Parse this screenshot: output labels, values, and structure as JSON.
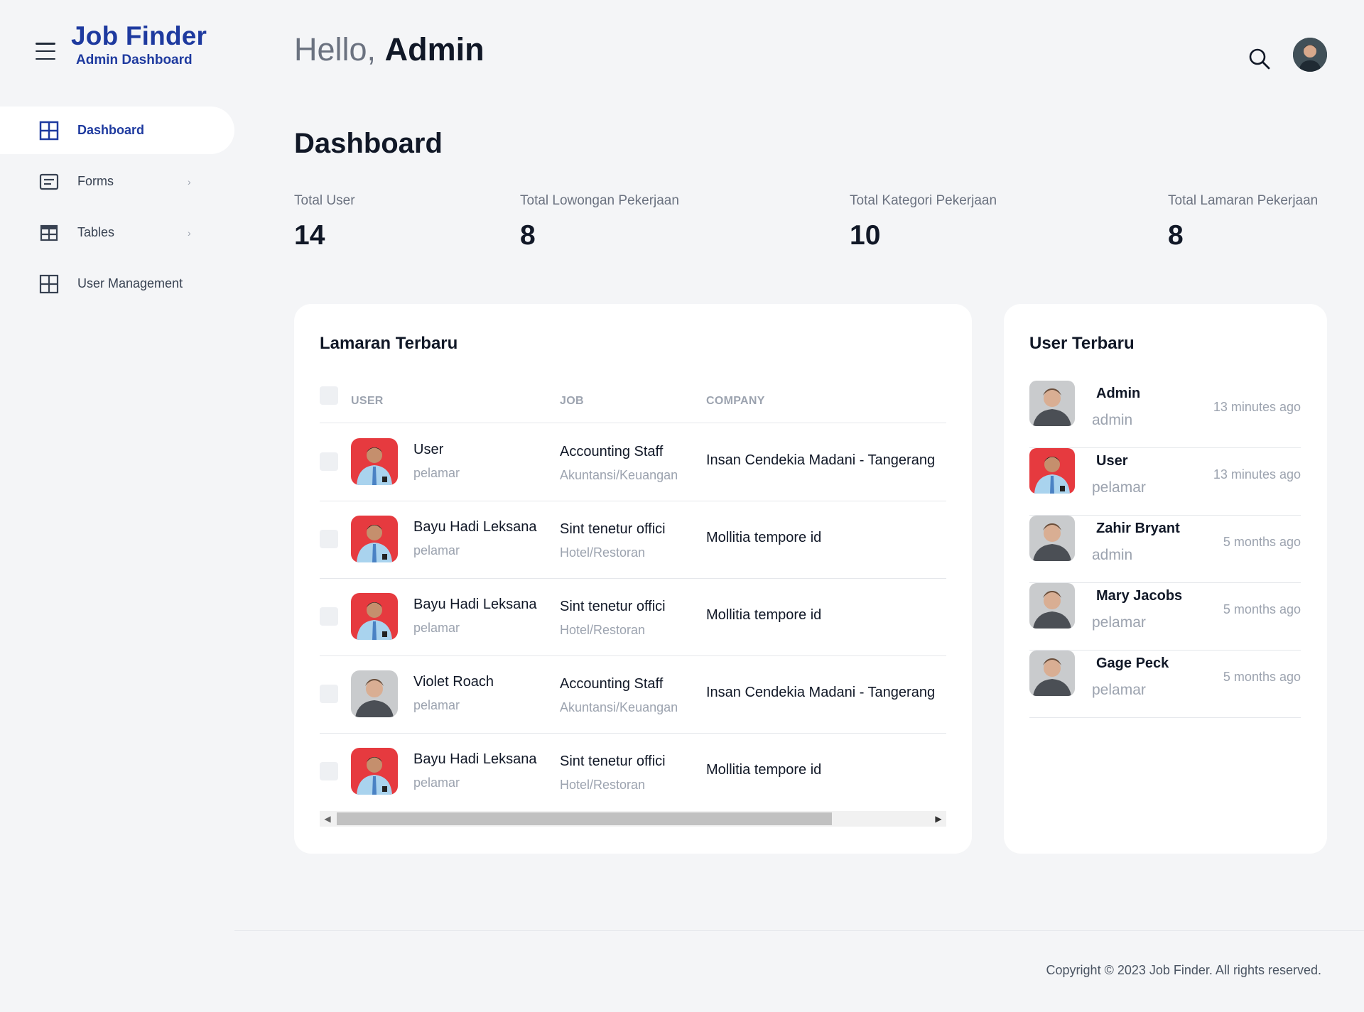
{
  "brand": {
    "title": "Job Finder",
    "subtitle": "Admin Dashboard"
  },
  "sidebar": {
    "items": [
      {
        "label": "Dashboard",
        "icon": "grid-icon",
        "active": true
      },
      {
        "label": "Forms",
        "icon": "form-icon",
        "has_submenu": true
      },
      {
        "label": "Tables",
        "icon": "table-icon",
        "has_submenu": true
      },
      {
        "label": "User Management",
        "icon": "grid-icon"
      }
    ],
    "chevron": "›"
  },
  "header": {
    "hello": "Hello,",
    "name": "Admin"
  },
  "page": {
    "title": "Dashboard"
  },
  "stats": [
    {
      "label": "Total User",
      "value": "14"
    },
    {
      "label": "Total Lowongan Pekerjaan",
      "value": "8"
    },
    {
      "label": "Total Kategori Pekerjaan",
      "value": "10"
    },
    {
      "label": "Total Lamaran Pekerjaan",
      "value": "8"
    }
  ],
  "applications": {
    "title": "Lamaran Terbaru",
    "columns": {
      "user": "USER",
      "job": "JOB",
      "company": "COMPANY"
    },
    "rows": [
      {
        "user": "User",
        "role": "pelamar",
        "job": "Accounting Staff",
        "category": "Akuntansi/Keuangan",
        "company": "Insan Cendekia Madani - Tangerang",
        "photo": "red-bg-photo"
      },
      {
        "user": "Bayu Hadi Leksana",
        "role": "pelamar",
        "job": "Sint tenetur offici",
        "category": "Hotel/Restoran",
        "company": "Mollitia tempore id",
        "photo": "red-bg-photo"
      },
      {
        "user": "Bayu Hadi Leksana",
        "role": "pelamar",
        "job": "Sint tenetur offici",
        "category": "Hotel/Restoran",
        "company": "Mollitia tempore id",
        "photo": "red-bg-photo"
      },
      {
        "user": "Violet Roach",
        "role": "pelamar",
        "job": "Accounting Staff",
        "category": "Akuntansi/Keuangan",
        "company": "Insan Cendekia Madani - Tangerang",
        "photo": "grey-bg-photo"
      },
      {
        "user": "Bayu Hadi Leksana",
        "role": "pelamar",
        "job": "Sint tenetur offici",
        "category": "Hotel/Restoran",
        "company": "Mollitia tempore id",
        "photo": "red-bg-photo"
      }
    ]
  },
  "users": {
    "title": "User Terbaru",
    "items": [
      {
        "name": "Admin",
        "role": "admin",
        "time": "13 minutes ago",
        "photo": "grey-bg-photo"
      },
      {
        "name": "User",
        "role": "pelamar",
        "time": "13 minutes ago",
        "photo": "red-bg-photo"
      },
      {
        "name": "Zahir Bryant",
        "role": "admin",
        "time": "5 months ago",
        "photo": "grey-bg-photo"
      },
      {
        "name": "Mary Jacobs",
        "role": "pelamar",
        "time": "5 months ago",
        "photo": "grey-bg-photo"
      },
      {
        "name": "Gage Peck",
        "role": "pelamar",
        "time": "5 months ago",
        "photo": "grey-bg-photo"
      }
    ]
  },
  "footer": {
    "copyright": "Copyright © 2023 Job Finder. All rights reserved."
  },
  "colors": {
    "brand": "#1e3a9f",
    "background": "#f4f5f7",
    "card": "#ffffff",
    "muted": "#9ca3af",
    "photo_red": "#e63a3f"
  }
}
